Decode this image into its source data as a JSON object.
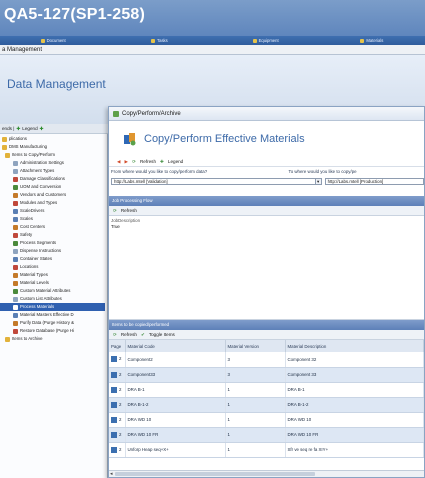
{
  "app": {
    "title": "QA5-127(SP1-258)"
  },
  "menu": [
    {
      "label": "Document",
      "icon": "document-icon"
    },
    {
      "label": "Tasks",
      "icon": "tasks-icon"
    },
    {
      "label": "Equipment",
      "icon": "equipment-icon"
    },
    {
      "label": "Materials",
      "icon": "materials-icon"
    }
  ],
  "breadcrumb": "a Management",
  "page": {
    "title": "Data Management"
  },
  "tree_toolbar": {
    "prefix": "ends |",
    "legend": "Legend"
  },
  "tree": [
    {
      "label": "plications",
      "icon": "folder-icon",
      "color": "#e2b23a"
    },
    {
      "label": "DMS Manufacturing",
      "icon": "folder-icon",
      "color": "#e2b23a"
    },
    {
      "label": "Items to Copy/Perform",
      "icon": "folder-icon",
      "color": "#e2b23a"
    },
    {
      "label": "Administration Settings",
      "icon": "settings-icon",
      "color": "#8fa4bf"
    },
    {
      "label": "Attachment Types",
      "icon": "attachment-icon",
      "color": "#8fa4bf"
    },
    {
      "label": "Damage Classifications",
      "icon": "damage-icon",
      "color": "#c0483b"
    },
    {
      "label": "UOM and Conversion",
      "icon": "uom-icon",
      "color": "#4b8a3c"
    },
    {
      "label": "Vendors and Customers",
      "icon": "vendors-icon",
      "color": "#c47a2a"
    },
    {
      "label": "Modules and Types",
      "icon": "modules-icon",
      "color": "#c0483b"
    },
    {
      "label": "ScaleDrivers",
      "icon": "scale-icon",
      "color": "#5a7fb4"
    },
    {
      "label": "Scales",
      "icon": "scales-icon",
      "color": "#5a7fb4"
    },
    {
      "label": "Cost Centers",
      "icon": "cost-center-icon",
      "color": "#c47a2a"
    },
    {
      "label": "Safety",
      "icon": "safety-icon",
      "color": "#c0483b"
    },
    {
      "label": "Process Segments",
      "icon": "process-icon",
      "color": "#4b8a3c"
    },
    {
      "label": "Dispense Instructions",
      "icon": "dispense-icon",
      "color": "#8fa4bf"
    },
    {
      "label": "Container States",
      "icon": "container-icon",
      "color": "#5a7fb4"
    },
    {
      "label": "Locations",
      "icon": "location-icon",
      "color": "#c0483b"
    },
    {
      "label": "Material Types",
      "icon": "material-type-icon",
      "color": "#c47a2a"
    },
    {
      "label": "Material Levels",
      "icon": "material-level-icon",
      "color": "#c47a2a"
    },
    {
      "label": "Custom Material Attributes",
      "icon": "attributes-icon",
      "color": "#4b8a3c"
    },
    {
      "label": "Custom List Attributes",
      "icon": "list-icon",
      "color": "#8fa4bf"
    },
    {
      "label": "Process Materials",
      "icon": "process-materials-icon",
      "color": "#ffffff",
      "selected": true
    },
    {
      "label": "Material Masters Effective D",
      "icon": "material-master-icon",
      "color": "#5a7fb4"
    },
    {
      "label": "Purify Data (Purge History &",
      "icon": "purge-icon",
      "color": "#c47a2a"
    },
    {
      "label": "Restore Database (Purge Hi",
      "icon": "restore-icon",
      "color": "#c0483b"
    },
    {
      "label": "Items to Archive",
      "icon": "folder-icon",
      "color": "#e2b23a"
    }
  ],
  "dialog": {
    "window_title": "Copy/Perform/Archive",
    "heading": "Copy/Perform Effective Materials",
    "toolbar": {
      "refresh": "Refresh",
      "legend": "Legend"
    },
    "from_label": "From where would you like to copy/perform data?",
    "to_label": "To where would you like to copy/pe",
    "from_value": "http://Labs.mtell [Validation]",
    "to_value": "http://Labs.mtell [Production]",
    "jobs_band": "Job Processing Flow",
    "jobs_toolbar": {
      "refresh": "Refresh"
    },
    "jobs_column": "JobDescription",
    "jobs_value": "True",
    "materials_band": "Items to be copied/performed",
    "materials_toolbar": {
      "refresh": "Refresh",
      "toggle": "Toggle Items"
    },
    "columns": [
      "Page",
      "Material Code",
      "Material Version",
      "Material Description"
    ],
    "rows": [
      {
        "page": "2",
        "code": "Component2",
        "version": "3",
        "description": "Component 32"
      },
      {
        "page": "2",
        "code": "Component33",
        "version": "3",
        "description": "Component 33"
      },
      {
        "page": "2",
        "code": "DRA B-1",
        "version": "1",
        "description": "DRA B-1"
      },
      {
        "page": "2",
        "code": "DRA B-1-2",
        "version": "1",
        "description": "DRA B-1-2"
      },
      {
        "page": "2",
        "code": "DRA WD 10",
        "version": "1",
        "description": "DRA WD 10"
      },
      {
        "page": "2",
        "code": "DRA WD 10 FR",
        "version": "1",
        "description": "DRA WD 10 FR"
      },
      {
        "page": "2",
        "code": "Unforp Heap seq+X+",
        "version": "1",
        "description": "Sfr ve seq re fa XIY+"
      }
    ]
  }
}
